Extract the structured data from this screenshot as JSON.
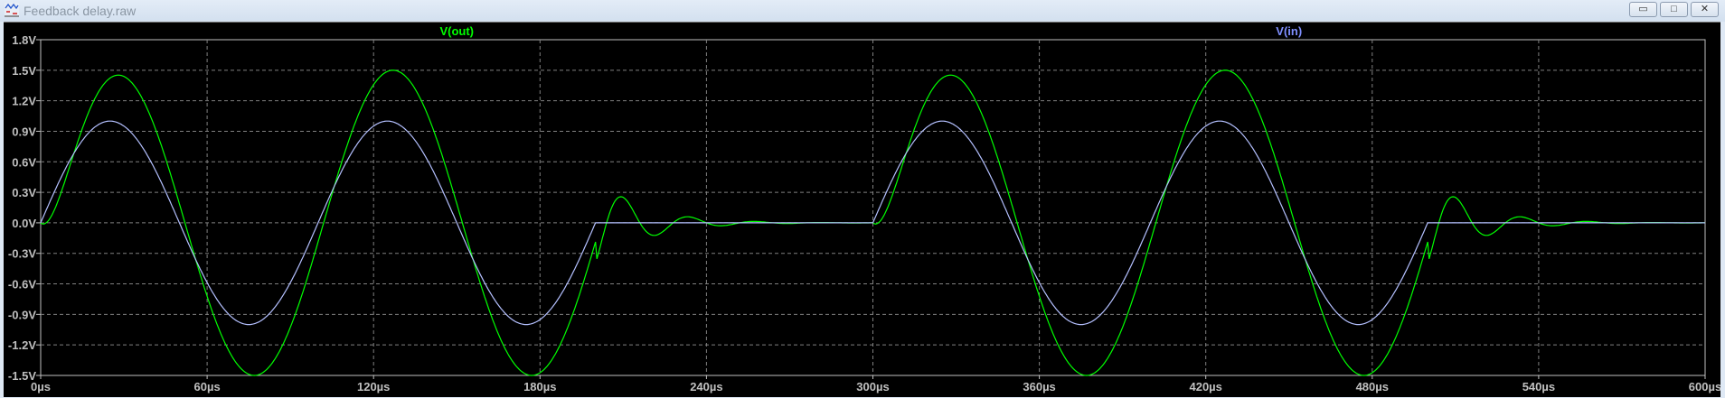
{
  "window": {
    "title": "Feedback delay.raw",
    "buttons": {
      "minimize": "▭",
      "restore": "□",
      "close": "✕"
    }
  },
  "colors": {
    "vout": "#00ff00",
    "vin": "#b4c0ff",
    "vin_label": "#7f8fff",
    "grid": "#808080",
    "axis_text": "#c0c0c0"
  },
  "chart_data": {
    "type": "line",
    "title": "",
    "xlabel": "",
    "ylabel": "",
    "xlim": [
      0,
      600
    ],
    "x_unit": "µs",
    "ylim": [
      -1.5,
      1.8
    ],
    "y_unit": "V",
    "grid": true,
    "xticks": [
      "0µs",
      "60µs",
      "120µs",
      "180µs",
      "240µs",
      "300µs",
      "360µs",
      "420µs",
      "480µs",
      "540µs",
      "600µs"
    ],
    "yticks": [
      "1.8V",
      "1.5V",
      "1.2V",
      "0.9V",
      "0.6V",
      "0.3V",
      "0.0V",
      "-0.3V",
      "-0.6V",
      "-0.9V",
      "-1.2V",
      "-1.5V"
    ],
    "xtick_values": [
      0,
      60,
      120,
      180,
      240,
      300,
      360,
      420,
      480,
      540,
      600
    ],
    "ytick_values": [
      1.8,
      1.5,
      1.2,
      0.9,
      0.6,
      0.3,
      0.0,
      -0.3,
      -0.6,
      -0.9,
      -1.2,
      -1.5
    ],
    "series": [
      {
        "name": "V(out)",
        "color": "#00ff00",
        "bursts_start_us": [
          0,
          300
        ],
        "burst_length_us": 200,
        "amplitude_V": 1.5,
        "period_us": 100,
        "lag_us": 2,
        "rise_tau_us": 8,
        "ringing": {
          "amplitude_V": 0.46,
          "period_us": 24,
          "decay_tau_us": 16.4,
          "peak_at_us_after_start": 210,
          "first_peak_V": 0.25,
          "first_trough_V": -0.12
        }
      },
      {
        "name": "V(in)",
        "color": "#b4c0ff",
        "bursts_start_us": [
          0,
          300
        ],
        "burst_length_us": 200,
        "amplitude_V": 1.0,
        "period_us": 100
      }
    ]
  }
}
